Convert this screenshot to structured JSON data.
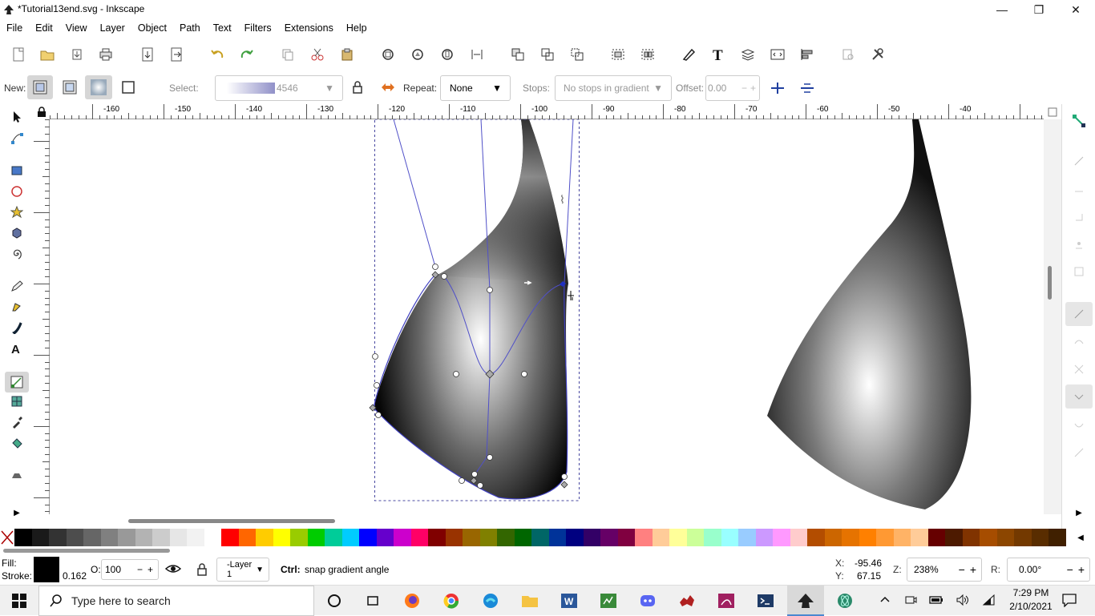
{
  "window": {
    "title": "*Tutorial13end.svg - Inkscape"
  },
  "menu": [
    "File",
    "Edit",
    "View",
    "Layer",
    "Object",
    "Path",
    "Text",
    "Filters",
    "Extensions",
    "Help"
  ],
  "ctrl": {
    "new_label": "New:",
    "select_label": "Select:",
    "select_value": "4546",
    "repeat_label": "Repeat:",
    "repeat_value": "None",
    "stops_label": "Stops:",
    "stops_value": "No stops in gradient",
    "offset_label": "Offset:",
    "offset_value": "0.00"
  },
  "ruler": {
    "ticks": [
      "-160",
      "-150",
      "-140",
      "-130",
      "-120",
      "-110",
      "-100",
      "-90",
      "-80",
      "-70",
      "-60",
      "-50",
      "-40"
    ]
  },
  "status": {
    "fill_label": "Fill:",
    "stroke_label": "Stroke:",
    "stroke_width": "0.162",
    "opacity_label": "O:",
    "opacity_value": "100",
    "layer": "-Layer 1",
    "hint_key": "Ctrl:",
    "hint_text": "snap gradient angle",
    "x_label": "X:",
    "x_value": "-95.46",
    "y_label": "Y:",
    "y_value": "67.15",
    "zoom_label": "Z:",
    "zoom_value": "238%",
    "rot_label": "R:",
    "rot_value": "0.00°"
  },
  "taskbar": {
    "search_placeholder": "Type here to search",
    "time": "7:29 PM",
    "date": "2/10/2021"
  },
  "colors": {
    "accent": "#4040c0",
    "palette": [
      "#000000",
      "#1a1a1a",
      "#333333",
      "#4d4d4d",
      "#666666",
      "#808080",
      "#999999",
      "#b3b3b3",
      "#cccccc",
      "#e6e6e6",
      "#f2f2f2",
      "#ffffff",
      "#ff0000",
      "#ff6600",
      "#ffcc00",
      "#ffff00",
      "#99cc00",
      "#00cc00",
      "#00cc99",
      "#00ccff",
      "#0000ff",
      "#6600cc",
      "#cc00cc",
      "#ff0066",
      "#800000",
      "#993300",
      "#996600",
      "#808000",
      "#336600",
      "#006600",
      "#006666",
      "#003399",
      "#000080",
      "#330066",
      "#660066",
      "#800040",
      "#ff8080",
      "#ffcc99",
      "#ffff99",
      "#ccff99",
      "#99ffcc",
      "#99ffff",
      "#99ccff",
      "#cc99ff",
      "#ff99ff",
      "#ffcccc",
      "#b34d00",
      "#cc6600",
      "#e67300",
      "#ff8000",
      "#ff9933",
      "#ffb366",
      "#ffcc99",
      "#660000",
      "#4d1a00",
      "#803300",
      "#a64d00",
      "#8c4600",
      "#733900",
      "#592d00",
      "#402000"
    ]
  }
}
